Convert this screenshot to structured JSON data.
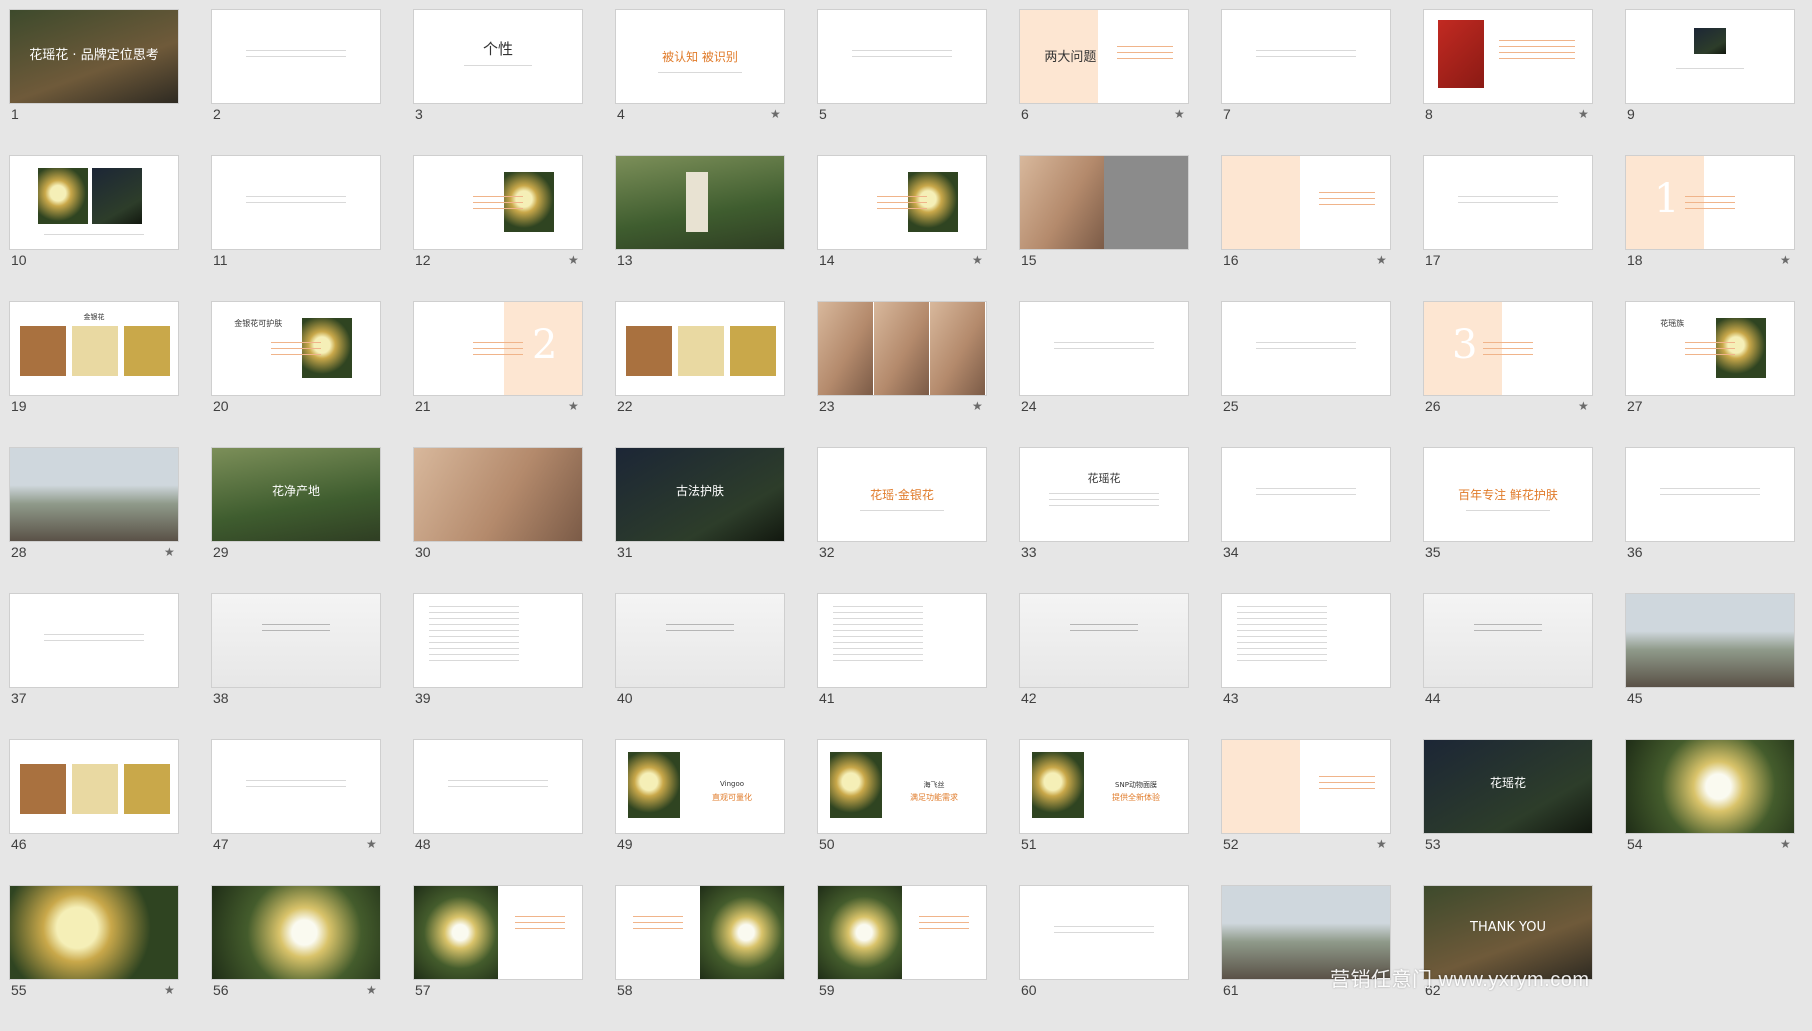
{
  "slides": [
    {
      "n": "1",
      "star": false,
      "kind": "photo",
      "ph": "ph-forest",
      "title": "花瑶花 · 品牌定位思考"
    },
    {
      "n": "2",
      "star": false,
      "kind": "text"
    },
    {
      "n": "3",
      "star": false,
      "kind": "title",
      "title": "个性"
    },
    {
      "n": "4",
      "star": true,
      "kind": "orange",
      "title": "被认知 被识别"
    },
    {
      "n": "5",
      "star": false,
      "kind": "text"
    },
    {
      "n": "6",
      "star": true,
      "kind": "peach-left",
      "title": "两大问题"
    },
    {
      "n": "7",
      "star": false,
      "kind": "text"
    },
    {
      "n": "8",
      "star": true,
      "kind": "can"
    },
    {
      "n": "9",
      "star": false,
      "kind": "smallphoto"
    },
    {
      "n": "10",
      "star": false,
      "kind": "twophoto"
    },
    {
      "n": "11",
      "star": false,
      "kind": "text"
    },
    {
      "n": "12",
      "star": true,
      "kind": "rightphoto"
    },
    {
      "n": "13",
      "star": false,
      "kind": "bottle"
    },
    {
      "n": "14",
      "star": true,
      "kind": "rightphoto"
    },
    {
      "n": "15",
      "star": false,
      "kind": "face"
    },
    {
      "n": "16",
      "star": true,
      "kind": "peach-left"
    },
    {
      "n": "17",
      "star": false,
      "kind": "text"
    },
    {
      "n": "18",
      "star": true,
      "kind": "digit-left",
      "digit": "1"
    },
    {
      "n": "19",
      "star": false,
      "kind": "collage",
      "title": "金银花"
    },
    {
      "n": "20",
      "star": false,
      "kind": "rightphoto",
      "title": "金银花可护肤"
    },
    {
      "n": "21",
      "star": true,
      "kind": "digit-right",
      "digit": "2"
    },
    {
      "n": "22",
      "star": false,
      "kind": "collage"
    },
    {
      "n": "23",
      "star": true,
      "kind": "faces"
    },
    {
      "n": "24",
      "star": false,
      "kind": "text"
    },
    {
      "n": "25",
      "star": false,
      "kind": "text"
    },
    {
      "n": "26",
      "star": true,
      "kind": "digit-left",
      "digit": "3"
    },
    {
      "n": "27",
      "star": false,
      "kind": "rightphoto",
      "title": "花瑶族"
    },
    {
      "n": "28",
      "star": true,
      "kind": "photo",
      "ph": "ph-mist"
    },
    {
      "n": "29",
      "star": false,
      "kind": "photo",
      "ph": "ph-green",
      "title": "花净产地"
    },
    {
      "n": "30",
      "star": false,
      "kind": "photo",
      "ph": "ph-face"
    },
    {
      "n": "31",
      "star": false,
      "kind": "photo",
      "ph": "ph-dark",
      "title": "古法护肤"
    },
    {
      "n": "32",
      "star": false,
      "kind": "orange",
      "title": "花瑶·金银花"
    },
    {
      "n": "33",
      "star": false,
      "kind": "title-small",
      "title": "花瑶花"
    },
    {
      "n": "34",
      "star": false,
      "kind": "text"
    },
    {
      "n": "35",
      "star": false,
      "kind": "orange",
      "title": "百年专注 鲜花护肤"
    },
    {
      "n": "36",
      "star": false,
      "kind": "text"
    },
    {
      "n": "37",
      "star": false,
      "kind": "text"
    },
    {
      "n": "38",
      "star": false,
      "kind": "sketch"
    },
    {
      "n": "39",
      "star": false,
      "kind": "list"
    },
    {
      "n": "40",
      "star": false,
      "kind": "sketch"
    },
    {
      "n": "41",
      "star": false,
      "kind": "list"
    },
    {
      "n": "42",
      "star": false,
      "kind": "sketch"
    },
    {
      "n": "43",
      "star": false,
      "kind": "list"
    },
    {
      "n": "44",
      "star": false,
      "kind": "sketch"
    },
    {
      "n": "45",
      "star": false,
      "kind": "photo",
      "ph": "ph-mist"
    },
    {
      "n": "46",
      "star": false,
      "kind": "collage"
    },
    {
      "n": "47",
      "star": true,
      "kind": "text"
    },
    {
      "n": "48",
      "star": false,
      "kind": "text"
    },
    {
      "n": "49",
      "star": false,
      "kind": "product",
      "title": "Vingoo",
      "sub": "直观可量化"
    },
    {
      "n": "50",
      "star": false,
      "kind": "product",
      "title": "海飞丝",
      "sub": "满足功能需求"
    },
    {
      "n": "51",
      "star": false,
      "kind": "product",
      "title": "SNP动物面膜",
      "sub": "提供全新体验"
    },
    {
      "n": "52",
      "star": true,
      "kind": "peach-left"
    },
    {
      "n": "53",
      "star": false,
      "kind": "photo",
      "ph": "ph-dark",
      "title": "花瑶花"
    },
    {
      "n": "54",
      "star": true,
      "kind": "photo",
      "ph": "ph-flower"
    },
    {
      "n": "55",
      "star": true,
      "kind": "photo",
      "ph": "ph-yellow"
    },
    {
      "n": "56",
      "star": true,
      "kind": "photo",
      "ph": "ph-flower"
    },
    {
      "n": "57",
      "star": false,
      "kind": "halfphoto"
    },
    {
      "n": "58",
      "star": false,
      "kind": "halfphoto-r"
    },
    {
      "n": "59",
      "star": false,
      "kind": "halfphoto"
    },
    {
      "n": "60",
      "star": false,
      "kind": "text"
    },
    {
      "n": "61",
      "star": false,
      "kind": "photo",
      "ph": "ph-mist"
    },
    {
      "n": "62",
      "star": false,
      "kind": "photo",
      "ph": "ph-forest",
      "title": "THANK YOU"
    }
  ],
  "watermark": "营销任意门 www.yxrym.com",
  "star_glyph": "★"
}
